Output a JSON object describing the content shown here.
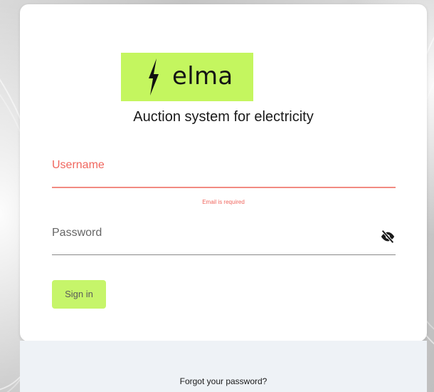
{
  "logo": {
    "text": "elma",
    "icon": "lightning-bolt-icon",
    "background_color": "#c4f65f"
  },
  "subtitle": "Auction system for electricity",
  "form": {
    "username": {
      "label": "Username",
      "value": "",
      "error": "Email is required",
      "state": "error"
    },
    "password": {
      "label": "Password",
      "value": "",
      "visibility_icon": "eye-off-icon"
    },
    "signin_label": "Sign in"
  },
  "footer": {
    "forgot_label": "Forgot your password?"
  },
  "colors": {
    "accent": "#c6f56a",
    "error": "#f0665e",
    "footer_bg": "#eef2f6"
  }
}
